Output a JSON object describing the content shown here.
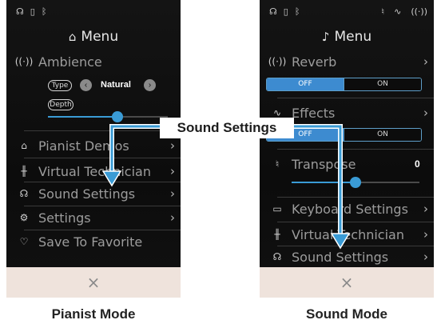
{
  "pianist_screen": {
    "status_icons": [
      "headphones-icon",
      "usb-icon",
      "bluetooth-icon"
    ],
    "title": "Menu",
    "ambience": {
      "label": "Ambience",
      "type_label": "Type",
      "type_value": "Natural",
      "depth_label": "Depth",
      "depth_fraction": 0.58
    },
    "items": [
      {
        "label": "Pianist Demos",
        "icon": "piano-icon"
      },
      {
        "label": "Virtual Technician",
        "icon": "technician-icon"
      },
      {
        "label": "Sound Settings",
        "icon": "headphones-icon"
      },
      {
        "label": "Settings",
        "icon": "gear-icon"
      },
      {
        "label": "Save To Favorite",
        "icon": "heart-icon"
      }
    ],
    "close": "×"
  },
  "sound_screen": {
    "status_icons": [
      "headphones-icon",
      "usb-icon",
      "bluetooth-icon",
      "transpose-icon",
      "effects-icon",
      "reverb-icon"
    ],
    "title": "Menu",
    "reverb": {
      "label": "Reverb",
      "off": "OFF",
      "on": "ON",
      "state": "off"
    },
    "effects": {
      "label": "Effects",
      "off": "OFF",
      "on": "ON",
      "state": "off"
    },
    "transpose": {
      "label": "Transpose",
      "value": "0",
      "fraction": 0.5
    },
    "items": [
      {
        "label": "Keyboard Settings",
        "icon": "keyboard-icon"
      },
      {
        "label": "Virtual Technician",
        "icon": "technician-icon"
      },
      {
        "label": "Sound Settings",
        "icon": "headphones-icon"
      }
    ],
    "close": "×"
  },
  "callout": "Sound Settings",
  "captions": {
    "left": "Pianist Mode",
    "right": "Sound Mode"
  },
  "colors": {
    "accent": "#3a9bd5",
    "close_bar": "#efe3dc",
    "background": "#111111"
  }
}
